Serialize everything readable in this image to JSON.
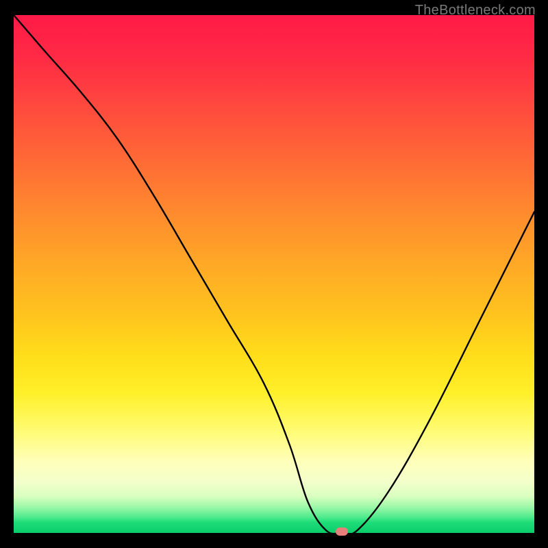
{
  "watermark": "TheBottleneck.com",
  "colors": {
    "curve": "#000000",
    "marker": "#e77f7a",
    "frame_bg": "#000000"
  },
  "chart_data": {
    "type": "line",
    "title": "",
    "xlabel": "",
    "ylabel": "",
    "xlim": [
      0,
      100
    ],
    "ylim": [
      0,
      100
    ],
    "grid": false,
    "legend": false,
    "note": "Axes have no tick labels in the source image; values are normalized 0–100. y represents bottleneck severity (0 = optimal/green, 100 = worst/red).",
    "series": [
      {
        "name": "bottleneck-curve",
        "x": [
          0,
          6,
          13,
          20,
          27,
          34,
          41,
          48,
          53,
          56.5,
          60,
          63,
          66,
          72,
          80,
          90,
          100
        ],
        "y": [
          100,
          93,
          85,
          76,
          65,
          53,
          41,
          29,
          17,
          6,
          0.5,
          0,
          0.5,
          8,
          22,
          42,
          62
        ]
      }
    ],
    "annotations": [
      {
        "name": "optimal-marker",
        "x": 63,
        "y": 0
      }
    ]
  }
}
